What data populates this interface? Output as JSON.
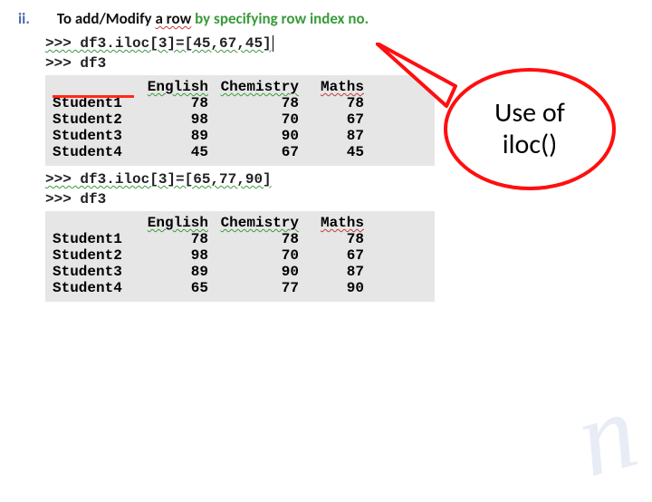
{
  "heading": {
    "num": "ii.",
    "pre": "To add/Modify ",
    "mid": "a  row",
    "post": "  by specifying row index no."
  },
  "code1": ">>> df3.iloc[3]=[45,67,45]",
  "code2": ">>> df3",
  "table1": {
    "cols": [
      "English",
      "Chemistry",
      "Maths"
    ],
    "rows": [
      {
        "idx": "Student1",
        "v": [
          "78",
          "78",
          "78"
        ]
      },
      {
        "idx": "Student2",
        "v": [
          "98",
          "70",
          "67"
        ]
      },
      {
        "idx": "Student3",
        "v": [
          "89",
          "90",
          "87"
        ]
      },
      {
        "idx": "Student4",
        "v": [
          "45",
          "67",
          "45"
        ]
      }
    ]
  },
  "code3": ">>> df3.iloc[3]=[65,77,90]",
  "code4": ">>> df3",
  "table2": {
    "cols": [
      "English",
      "Chemistry",
      "Maths"
    ],
    "rows": [
      {
        "idx": "Student1",
        "v": [
          "78",
          "78",
          "78"
        ]
      },
      {
        "idx": "Student2",
        "v": [
          "98",
          "70",
          "67"
        ]
      },
      {
        "idx": "Student3",
        "v": [
          "89",
          "90",
          "87"
        ]
      },
      {
        "idx": "Student4",
        "v": [
          "65",
          "77",
          "90"
        ]
      }
    ]
  },
  "callout": {
    "line1": "Use of",
    "line2": "iloc()"
  },
  "watermark": "n"
}
